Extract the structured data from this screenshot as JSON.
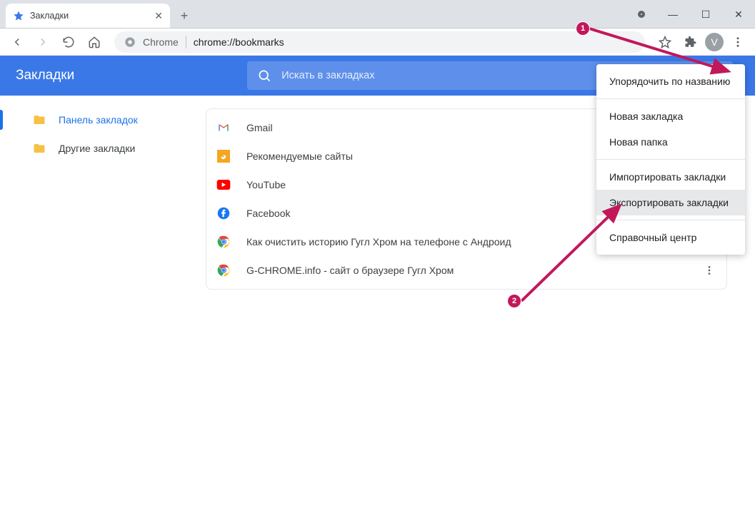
{
  "window": {
    "tab_title": "Закладки",
    "new_tab_glyph": "+",
    "minimize_glyph": "—",
    "maximize_glyph": "☐",
    "close_glyph": "✕"
  },
  "toolbar": {
    "chrome_label": "Chrome",
    "url": "chrome://bookmarks",
    "avatar_letter": "V"
  },
  "bookmarks": {
    "header_title": "Закладки",
    "search_placeholder": "Искать в закладках",
    "sidebar": [
      {
        "label": "Панель закладок",
        "active": true
      },
      {
        "label": "Другие закладки",
        "active": false
      }
    ],
    "items": [
      {
        "label": "Gmail",
        "icon": "gmail"
      },
      {
        "label": "Рекомендуемые сайты",
        "icon": "bing"
      },
      {
        "label": "YouTube",
        "icon": "youtube"
      },
      {
        "label": "Facebook",
        "icon": "facebook"
      },
      {
        "label": "Как очистить историю Гугл Хром на телефоне с Андроид",
        "icon": "chrome"
      },
      {
        "label": "G-CHROME.info - сайт о браузере Гугл Хром",
        "icon": "chrome"
      }
    ]
  },
  "menu": {
    "sort": "Упорядочить по названию",
    "new_bookmark": "Новая закладка",
    "new_folder": "Новая папка",
    "import": "Импортировать закладки",
    "export": "Экспортировать закладки",
    "help": "Справочный центр"
  },
  "annotation": {
    "badge1": "1",
    "badge2": "2"
  }
}
